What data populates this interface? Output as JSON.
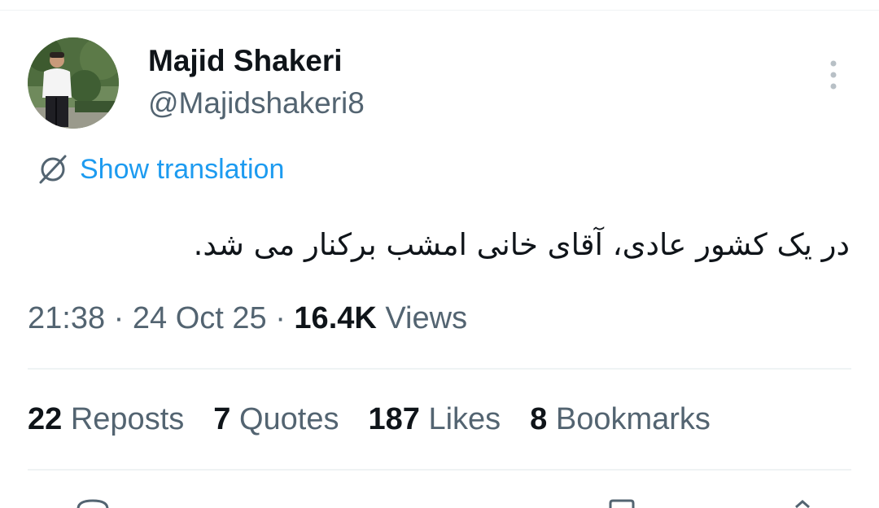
{
  "author": {
    "name": "Majid Shakeri",
    "handle": "@Majidshakeri8"
  },
  "translation": {
    "label": "Show translation"
  },
  "tweet": {
    "text": "در یک کشور عادی، آقای خانی امشب برکنار می شد."
  },
  "meta": {
    "time": "21:38",
    "sep1": " · ",
    "date": "24 Oct 25",
    "sep2": " · ",
    "views_count": "16.4K",
    "views_label": " Views"
  },
  "stats": [
    {
      "count": "22",
      "label": "Reposts"
    },
    {
      "count": "7",
      "label": "Quotes"
    },
    {
      "count": "187",
      "label": "Likes"
    },
    {
      "count": "8",
      "label": "Bookmarks"
    }
  ],
  "icons": {
    "more": "more-vertical-icon",
    "translate": "translate-icon"
  },
  "colors": {
    "link": "#1d9bf0",
    "secondary_text": "#536471",
    "primary_text": "#0f1419",
    "divider": "#eff3f4"
  }
}
